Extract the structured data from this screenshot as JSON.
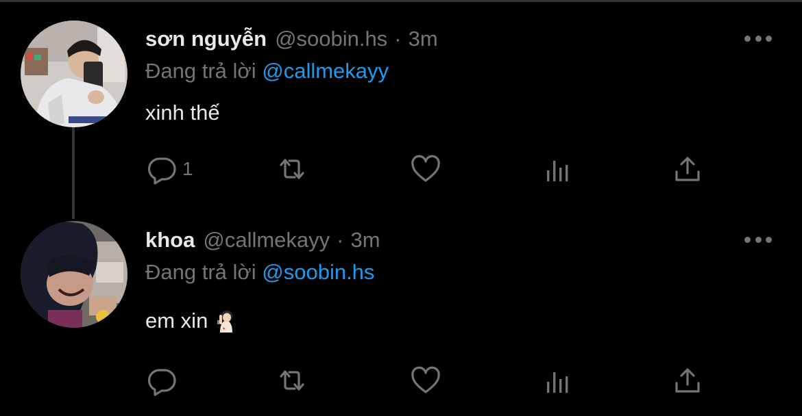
{
  "thread": [
    {
      "display_name": "sơn nguyễn",
      "handle": "@soobin.hs",
      "separator": "·",
      "time": "3m",
      "replying_prefix": "Đang trả lời",
      "replying_to": "@callmekayy",
      "text": "xinh thế",
      "reply_count": "1",
      "avatar_icon": "avatar-photo-mirror-selfie"
    },
    {
      "display_name": "khoa",
      "handle": "@callmekayy",
      "separator": "·",
      "time": "3m",
      "replying_prefix": "Đang trả lời",
      "replying_to": "@soobin.hs",
      "text": "em xin",
      "reply_count": "",
      "emoji_icon": "person-shushing-emoji",
      "avatar_icon": "avatar-photo-hooded-laughing"
    }
  ],
  "colors": {
    "background": "#000000",
    "primary_text": "#e7e9ea",
    "secondary_text": "#71767b",
    "mention": "#1d9bf0",
    "thread_line": "#333639"
  },
  "icons": {
    "reply": "speech-bubble-icon",
    "retweet": "retweet-arrows-icon",
    "like": "heart-icon",
    "views": "bar-chart-icon",
    "share": "share-upload-icon",
    "more": "more-dots-icon"
  }
}
